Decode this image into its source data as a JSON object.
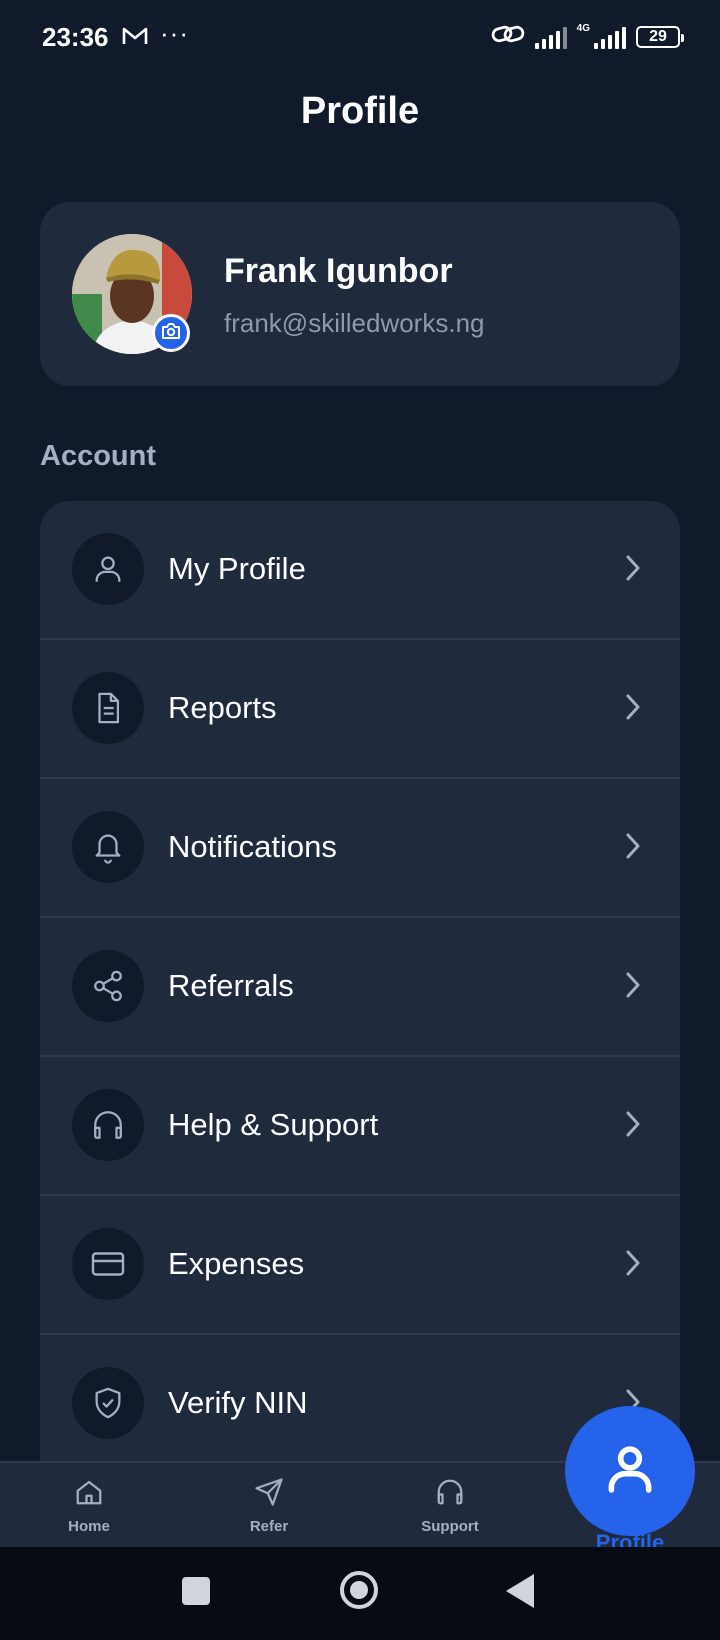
{
  "status_bar": {
    "time": "23:36",
    "dots": "···",
    "network": "4G",
    "battery": "29"
  },
  "page": {
    "title": "Profile"
  },
  "profile": {
    "name": "Frank Igunbor",
    "email": "frank@skilledworks.ng"
  },
  "account": {
    "section_label": "Account",
    "items": [
      {
        "label": "My Profile",
        "icon": "user-icon"
      },
      {
        "label": "Reports",
        "icon": "document-icon"
      },
      {
        "label": "Notifications",
        "icon": "bell-icon"
      },
      {
        "label": "Referrals",
        "icon": "share-icon"
      },
      {
        "label": "Help & Support",
        "icon": "headphones-icon"
      },
      {
        "label": "Expenses",
        "icon": "credit-card-icon"
      },
      {
        "label": "Verify NIN",
        "icon": "shield-check-icon"
      }
    ]
  },
  "bottom_nav": {
    "items": [
      {
        "label": "Home",
        "icon": "home-icon"
      },
      {
        "label": "Refer",
        "icon": "send-icon"
      },
      {
        "label": "Support",
        "icon": "headphones-icon"
      },
      {
        "label": "Profile",
        "icon": "user-icon",
        "active": true
      }
    ]
  },
  "colors": {
    "background": "#111a2b",
    "card": "#1f2a3d",
    "accent": "#2563eb",
    "muted_text": "#a3afc2"
  }
}
